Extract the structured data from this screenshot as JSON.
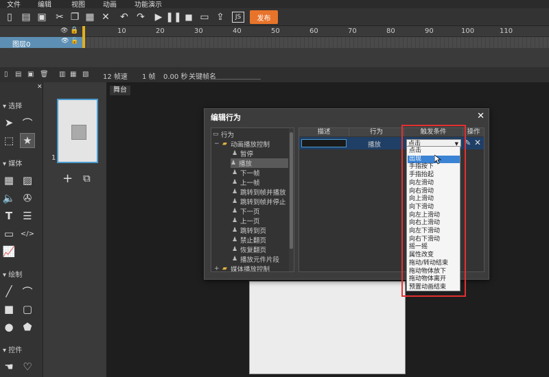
{
  "menu": [
    "文件",
    "编辑",
    "视图",
    "动画",
    "功能演示"
  ],
  "toolbar": {
    "publish_label": "发布"
  },
  "timeline": {
    "ticks": [
      "10",
      "20",
      "30",
      "40",
      "50",
      "60",
      "70",
      "80",
      "90",
      "100",
      "110"
    ],
    "layer_name": "图层0",
    "status": {
      "fps": "12 帧速",
      "frame": "1 帧",
      "time": "0.00 秒",
      "keyframe_label": "关键帧名"
    }
  },
  "tools": {
    "sections": [
      "选择",
      "媒体",
      "绘制",
      "控件"
    ]
  },
  "pages": {
    "page_number": "1"
  },
  "stage": {
    "tab_label": "舞台"
  },
  "dialog": {
    "title": "编辑行为",
    "tree": [
      "行为",
      "动画播放控制",
      "暂停",
      "播放",
      "下一帧",
      "上一帧",
      "跳转到帧并播放",
      "跳转到帧并停止",
      "下一页",
      "上一页",
      "跳转到页",
      "禁止翻页",
      "恢复翻页",
      "播放元件片段",
      "媒体播放控制"
    ],
    "columns": [
      "描述",
      "行为",
      "触发条件",
      "操作"
    ],
    "row": {
      "action": "播放",
      "trigger": "点击"
    },
    "trigger_options": [
      "点击",
      "出现",
      "手指按下",
      "手指抬起",
      "向左滑动",
      "向右滑动",
      "向上滑动",
      "向下滑动",
      "向左上滑动",
      "向右上滑动",
      "向左下滑动",
      "向右下滑动",
      "摇一摇",
      "属性改变",
      "拖动/转动结束",
      "拖动物体放下",
      "拖动物体离开",
      "预置动画结束"
    ],
    "highlighted_option": "出现"
  },
  "colors": {
    "accent": "#e8742b",
    "selection": "#3b83d4",
    "highlight_box": "#e53030"
  }
}
